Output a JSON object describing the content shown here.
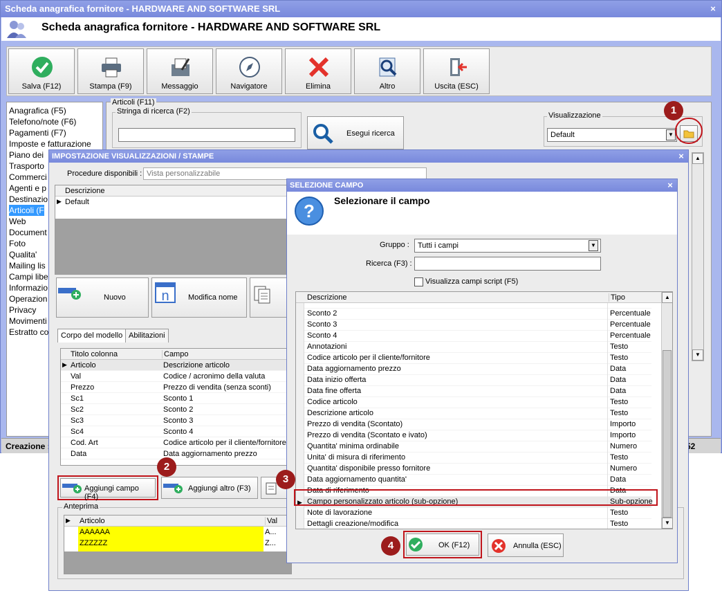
{
  "main_window": {
    "title": "Scheda anagrafica fornitore - HARDWARE AND SOFTWARE SRL",
    "heading": "Scheda anagrafica fornitore - HARDWARE AND SOFTWARE SRL",
    "close_glyph": "×"
  },
  "toolbar": [
    {
      "label": "Salva (F12)",
      "icon": "check-circle-icon"
    },
    {
      "label": "Stampa (F9)",
      "icon": "printer-icon"
    },
    {
      "label": "Messaggio",
      "icon": "message-icon"
    },
    {
      "label": "Navigatore",
      "icon": "compass-icon"
    },
    {
      "label": "Elimina",
      "icon": "red-x-icon"
    },
    {
      "label": "Altro",
      "icon": "magnifier-icon"
    },
    {
      "label": "Uscita (ESC)",
      "icon": "exit-door-icon"
    }
  ],
  "nav": {
    "items": [
      "Anagrafica (F5)",
      "Telefono/note (F6)",
      "Pagamenti (F7)",
      "Imposte e fatturazione",
      "Piano dei",
      "Trasporto",
      "Commerci",
      "Agenti e p",
      "Destinazio",
      "Articoli (F",
      "Web",
      "Document",
      "Foto",
      "Qualita'",
      "Mailing lis",
      "Campi libe",
      "Informazio",
      "Operazion",
      "Privacy",
      "Movimenti",
      "Estratto co"
    ],
    "selected_index": 9
  },
  "articoli": {
    "group_label": "Articoli (F11)",
    "search_label": "Stringa di ricerca (F2)",
    "search_value": "",
    "search_button": "Esegui ricerca",
    "view_label": "Visualizzazione",
    "view_value": "Default"
  },
  "status": {
    "left": "Creazione :",
    "right": "52"
  },
  "dialog1": {
    "title": "IMPOSTAZIONE VISUALIZZAZIONI / STAMPE",
    "close_glyph": "×",
    "procedures_label": "Procedure disponibili :",
    "procedures_value": "Vista personalizzabile",
    "grid_header": "Descrizione",
    "grid_rows": [
      "Default"
    ],
    "btn_new": "Nuovo",
    "btn_rename": "Modifica nome",
    "tabs": [
      "Corpo del modello",
      "Abilitazioni"
    ],
    "columns_headers": [
      "Titolo colonna",
      "Campo"
    ],
    "columns_rows": [
      [
        "Articolo",
        "Descrizione articolo"
      ],
      [
        "Val",
        "Codice / acronimo della valuta"
      ],
      [
        "Prezzo",
        "Prezzo di vendita (senza sconti)"
      ],
      [
        "Sc1",
        "Sconto 1"
      ],
      [
        "Sc2",
        "Sconto 2"
      ],
      [
        "Sc3",
        "Sconto 3"
      ],
      [
        "Sc4",
        "Sconto 4"
      ],
      [
        "Cod. Art",
        "Codice articolo per il cliente/fornitore"
      ],
      [
        "Data",
        "Data aggiornamento prezzo"
      ]
    ],
    "btn_add_field": "Aggiungi campo (F4)",
    "btn_add_other": "Aggiungi altro (F3)",
    "preview_label": "Anteprima",
    "preview_headers": [
      "Articolo",
      "Val"
    ],
    "preview_rows": [
      [
        "AAAAAA",
        "A..."
      ],
      [
        "ZZZZZZ",
        "Z..."
      ]
    ],
    "preview_highlight": "#ffff00"
  },
  "dialog2": {
    "title": "SELEZIONE CAMPO",
    "close_glyph": "×",
    "heading": "Selezionare il campo",
    "group_label": "Gruppo :",
    "group_value": "Tutti i campi",
    "search_label": "Ricerca (F3) :",
    "search_value": "",
    "script_checkbox_label": "Visualizza campi script (F5)",
    "list_headers": [
      "Descrizione",
      "Tipo"
    ],
    "list_rows": [
      [
        "",
        ""
      ],
      [
        "Sconto 2",
        "Percentuale"
      ],
      [
        "Sconto 3",
        "Percentuale"
      ],
      [
        "Sconto 4",
        "Percentuale"
      ],
      [
        "Annotazioni",
        "Testo"
      ],
      [
        "Codice articolo per il cliente/fornitore",
        "Testo"
      ],
      [
        "Data aggiornamento prezzo",
        "Data"
      ],
      [
        "Data inizio offerta",
        "Data"
      ],
      [
        "Data fine offerta",
        "Data"
      ],
      [
        "Codice articolo",
        "Testo"
      ],
      [
        "Descrizione articolo",
        "Testo"
      ],
      [
        "Prezzo di vendita (Scontato)",
        "Importo"
      ],
      [
        "Prezzo di vendita (Scontato e ivato)",
        "Importo"
      ],
      [
        "Quantita' minima ordinabile",
        "Numero"
      ],
      [
        "Unita' di misura di riferimento",
        "Testo"
      ],
      [
        "Quantita' disponibile presso fornitore",
        "Numero"
      ],
      [
        "Data aggiornamento quantita'",
        "Data"
      ],
      [
        "Data di riferimento",
        "Data"
      ],
      [
        "Campo personalizzato articolo (sub-opzione)",
        "Sub-opzione"
      ],
      [
        "Note di lavorazione",
        "Testo"
      ],
      [
        "Dettagli creazione/modifica",
        "Testo"
      ]
    ],
    "selected_index": 18,
    "btn_ok": "OK (F12)",
    "btn_cancel": "Annulla (ESC)"
  },
  "markers": [
    "1",
    "2",
    "3",
    "4"
  ],
  "colors": {
    "title_bar": "#7889dc",
    "marker": "#9c1c1c",
    "highlight_border": "#c0141b",
    "selection": "#3399ff"
  }
}
